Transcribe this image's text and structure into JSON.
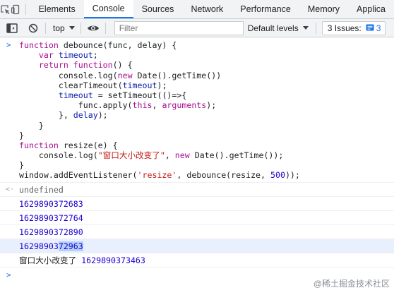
{
  "tabs": [
    {
      "label": "Elements",
      "active": false
    },
    {
      "label": "Console",
      "active": true
    },
    {
      "label": "Sources",
      "active": false
    },
    {
      "label": "Network",
      "active": false
    },
    {
      "label": "Performance",
      "active": false
    },
    {
      "label": "Memory",
      "active": false
    },
    {
      "label": "Applica",
      "active": false
    }
  ],
  "toolbar": {
    "context": "top",
    "filter_placeholder": "Filter",
    "levels": "Default levels",
    "issues_label": "3 Issues:",
    "issues_count": "3"
  },
  "console": {
    "prompt": ">",
    "return_value": "undefined",
    "logs": [
      "1629890372683",
      "1629890372764",
      "1629890372890"
    ],
    "selected_log": {
      "prefix": "16298903",
      "highlight": "72963"
    },
    "cn_log": {
      "text": "窗口大小改变了",
      "value": "1629890373463"
    }
  },
  "watermark": "@稀土掘金技术社区",
  "colors": {
    "accent": "#1a73e8",
    "keyword": "#aa0d91",
    "string": "#c41a16",
    "number": "#1c00cf"
  }
}
